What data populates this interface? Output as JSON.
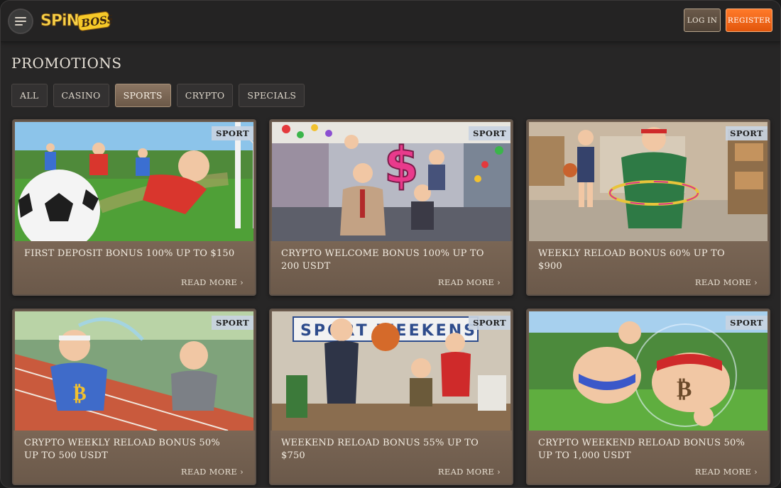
{
  "header": {
    "logo": "SPIN BOSS",
    "login_label": "LOG IN",
    "register_label": "REGISTER"
  },
  "page": {
    "title": "PROMOTIONS"
  },
  "tabs": [
    {
      "label": "ALL",
      "active": false
    },
    {
      "label": "CASINO",
      "active": false
    },
    {
      "label": "SPORTS",
      "active": true
    },
    {
      "label": "CRYPTO",
      "active": false
    },
    {
      "label": "SPECIALS",
      "active": false
    }
  ],
  "cards": [
    {
      "badge": "SPORT",
      "title": "FIRST DEPOSIT BONUS 100% UP TO $150",
      "link": "READ MORE"
    },
    {
      "badge": "SPORT",
      "title": "CRYPTO WELCOME BONUS 100% UP TO 200 USDT",
      "link": "READ MORE"
    },
    {
      "badge": "SPORT",
      "title": "WEEKLY RELOAD BONUS 60% UP TO $900",
      "link": "READ MORE"
    },
    {
      "badge": "SPORT",
      "title": "CRYPTO WEEKLY RELOAD BONUS 50% UP TO 500 USDT",
      "link": "READ MORE"
    },
    {
      "badge": "SPORT",
      "title": "WEEKEND RELOAD BONUS 55% UP TO $750",
      "link": "READ MORE"
    },
    {
      "badge": "SPORT",
      "title": "CRYPTO WEEKEND RELOAD BONUS 50% UP TO 1,000 USDT",
      "link": "READ MORE"
    }
  ],
  "colors": {
    "accent_register": "#e2560c",
    "tab_active": "#7b6654",
    "card_body": "#6b594a"
  },
  "icons": {
    "menu": "hamburger-icon",
    "read_more": "chevron-right-icon"
  }
}
